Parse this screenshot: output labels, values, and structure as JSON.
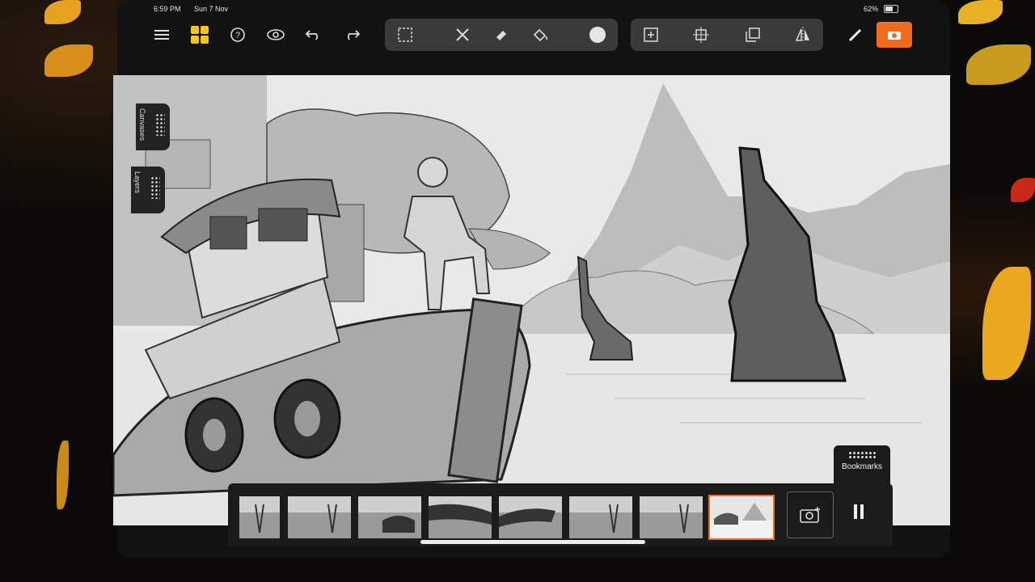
{
  "status_bar": {
    "time": "6:59 PM",
    "date": "Sun 7 Nov",
    "battery": "62%"
  },
  "toolbar": {
    "left": [
      {
        "name": "menu-icon",
        "icon": "menu"
      },
      {
        "name": "apps-icon",
        "icon": "apps",
        "color": "#f5c518"
      },
      {
        "name": "help-icon",
        "icon": "help"
      },
      {
        "name": "onion-skin-icon",
        "icon": "onion"
      },
      {
        "name": "undo-icon",
        "icon": "undo"
      },
      {
        "name": "redo-icon",
        "icon": "redo"
      }
    ],
    "tools": [
      "selection-icon",
      "cut-icon",
      "eraser-icon",
      "fill-icon",
      "brush-size-icon"
    ],
    "canvas_tools": [
      "add-frame-icon",
      "transform-icon",
      "layer-copy-icon",
      "flip-icon"
    ],
    "pen_color": "#f26b1d"
  },
  "side_tabs": {
    "canvases": "Canvases",
    "layers": "Layers"
  },
  "timeline": {
    "frame_count": 8,
    "selected_index": 7,
    "bookmarks_label": "Bookmarks"
  }
}
